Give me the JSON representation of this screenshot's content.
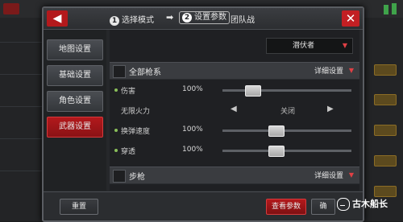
{
  "header": {
    "step1_num": "1",
    "step1_label": "选择模式",
    "arrow": "➡",
    "step2_num": "2",
    "step2_label": "设置参数",
    "mode_name": "团队战",
    "back_icon": "◀",
    "close_icon": "✕"
  },
  "sidebar": {
    "items": [
      {
        "label": "地图设置"
      },
      {
        "label": "基础设置"
      },
      {
        "label": "角色设置"
      },
      {
        "label": "武器设置"
      }
    ],
    "active_index": 3
  },
  "content": {
    "mode_select": {
      "value": "潜伏者",
      "caret": "▼"
    },
    "sections": [
      {
        "title": "全部枪系",
        "detail_label": "详细设置",
        "caret": "▼",
        "params": [
          {
            "name": "伤害",
            "value": "100%",
            "type": "slider",
            "level": 0.2
          },
          {
            "name": "无限火力",
            "value": "关闭",
            "type": "toggle",
            "left_arrow": "◀",
            "right_arrow": "▶"
          },
          {
            "name": "换弹速度",
            "value": "100%",
            "type": "slider",
            "level": 0.4
          },
          {
            "name": "穿透",
            "value": "100%",
            "type": "slider",
            "level": 0.4
          }
        ]
      },
      {
        "title": "步枪",
        "detail_label": "详细设置",
        "caret": "▼"
      }
    ]
  },
  "footer": {
    "reset_label": "重置",
    "view_params_label": "查看参数",
    "confirm_label": "确"
  },
  "watermark": {
    "text": "古木船长"
  },
  "colors": {
    "accent_red": "#b3191c",
    "panel_bg": "#26282b",
    "active_dot": "#8abf5a"
  }
}
